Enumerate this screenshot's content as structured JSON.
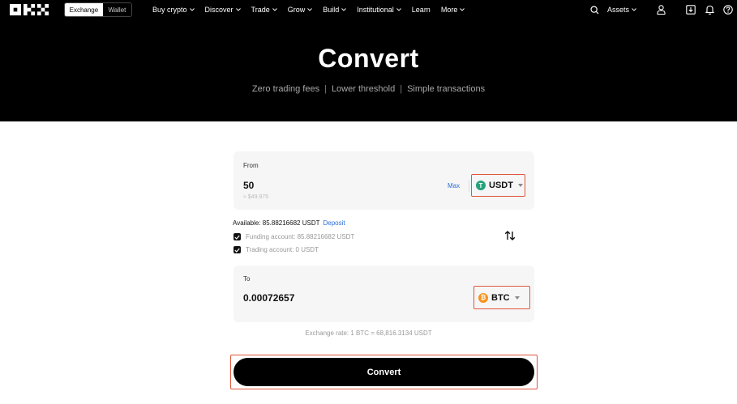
{
  "nav": {
    "tabs": [
      {
        "label": "Exchange",
        "active": true
      },
      {
        "label": "Wallet",
        "active": false
      }
    ],
    "menu": [
      {
        "label": "Buy crypto",
        "dropdown": true
      },
      {
        "label": "Discover",
        "dropdown": true
      },
      {
        "label": "Trade",
        "dropdown": true
      },
      {
        "label": "Grow",
        "dropdown": true
      },
      {
        "label": "Build",
        "dropdown": true
      },
      {
        "label": "Institutional",
        "dropdown": true
      },
      {
        "label": "Learn",
        "dropdown": false
      },
      {
        "label": "More",
        "dropdown": true
      }
    ],
    "assets_label": "Assets",
    "icons": [
      "search-icon",
      "user-icon",
      "download-icon",
      "bell-icon",
      "help-icon"
    ]
  },
  "hero": {
    "title": "Convert",
    "features": [
      "Zero trading fees",
      "Lower threshold",
      "Simple transactions"
    ],
    "separator": "|"
  },
  "from": {
    "label": "From",
    "amount": "50",
    "fiat": "≈ $49.975",
    "max_label": "Max",
    "coin": "USDT",
    "coin_glyph": "T",
    "coin_color": "#26a17b"
  },
  "balance": {
    "available": "Available: 85.88216682 USDT",
    "deposit_label": "Deposit",
    "funding": "Funding account: 85.88216682 USDT",
    "trading": "Trading account: 0 USDT"
  },
  "to": {
    "label": "To",
    "amount": "0.00072657",
    "coin": "BTC",
    "coin_glyph": "₿",
    "coin_color": "#f7931a"
  },
  "rate": "Exchange rate: 1 BTC = 68,816.3134 USDT",
  "convert_label": "Convert",
  "colors": {
    "accent_link": "#2b6fd6",
    "highlight_outline": "#e0563c",
    "header_bg": "#000000"
  }
}
